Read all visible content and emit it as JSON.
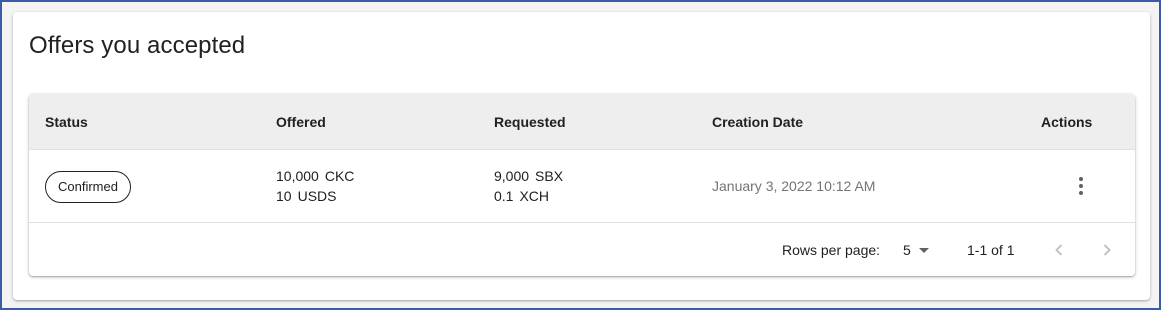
{
  "page": {
    "title": "Offers you accepted"
  },
  "table": {
    "headers": {
      "status": "Status",
      "offered": "Offered",
      "requested": "Requested",
      "creation_date": "Creation Date",
      "actions": "Actions"
    },
    "rows": [
      {
        "status": "Confirmed",
        "offered": [
          {
            "amount": "10,000",
            "unit": "CKC"
          },
          {
            "amount": "10",
            "unit": "USDS"
          }
        ],
        "requested": [
          {
            "amount": "9,000",
            "unit": "SBX"
          },
          {
            "amount": "0.1",
            "unit": "XCH"
          }
        ],
        "creation_date": "January 3, 2022 10:12 AM",
        "actions_icon": "more-vert-icon"
      }
    ]
  },
  "pagination": {
    "rows_per_page_label": "Rows per page:",
    "rows_per_page_value": "5",
    "range_label": "1-1 of 1",
    "prev_icon": "chevron-left-icon",
    "next_icon": "chevron-right-icon"
  },
  "colors": {
    "frame_border": "#3c5aa6",
    "header_bg": "#eeeeee",
    "date_text": "#757575",
    "disabled_icon": "#bdbdbd"
  }
}
